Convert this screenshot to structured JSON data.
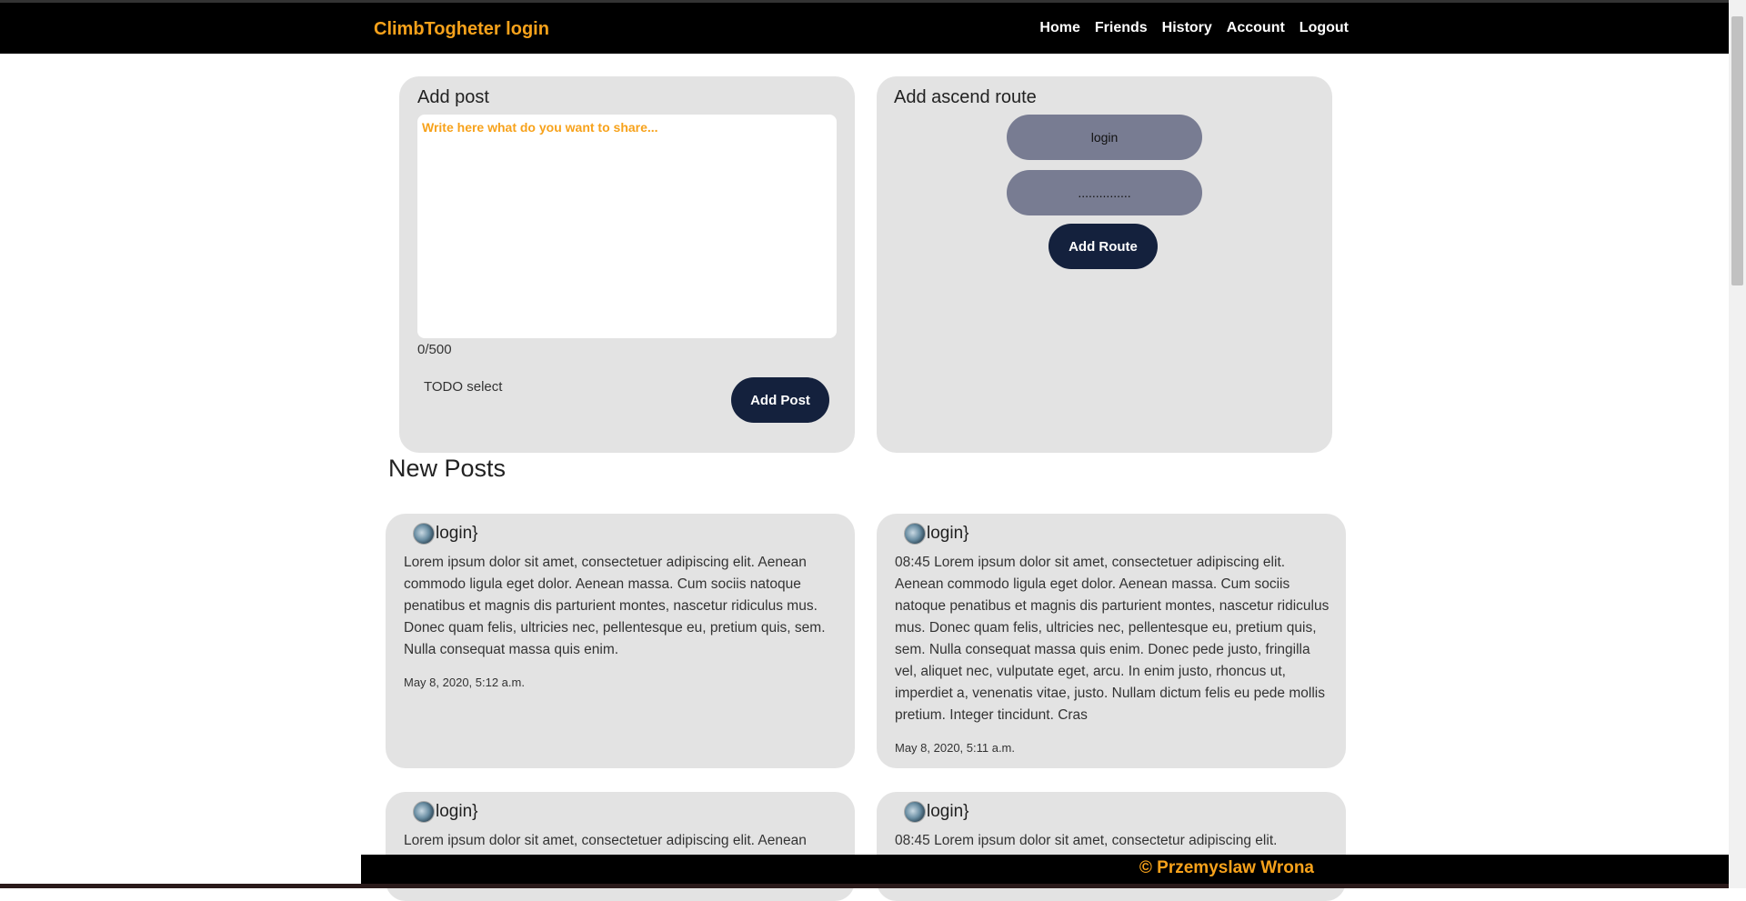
{
  "brand": "ClimbTogheter login",
  "nav": [
    "Home",
    "Friends",
    "History",
    "Account",
    "Logout"
  ],
  "add_post": {
    "title": "Add post",
    "placeholder": "Write here what do you want to share...",
    "char_count": "0/500",
    "todo_select": "TODO select",
    "submit_label": "Add Post"
  },
  "add_route": {
    "title": "Add ascend route",
    "login_placeholder": "login",
    "password_value": "...............",
    "submit_label": "Add Route"
  },
  "new_posts_title": "New Posts",
  "posts": [
    {
      "author": "login}",
      "body": "Lorem ipsum dolor sit amet, consectetuer adipiscing elit. Aenean commodo ligula eget dolor. Aenean massa. Cum sociis natoque penatibus et magnis dis parturient montes, nascetur ridiculus mus. Donec quam felis, ultricies nec, pellentesque eu, pretium quis, sem. Nulla consequat massa quis enim.",
      "date": "May 8, 2020, 5:12 a.m."
    },
    {
      "author": "login}",
      "body": "08:45 Lorem ipsum dolor sit amet, consectetuer adipiscing elit. Aenean commodo ligula eget dolor. Aenean massa. Cum sociis natoque penatibus et magnis dis parturient montes, nascetur ridiculus mus. Donec quam felis, ultricies nec, pellentesque eu, pretium quis, sem. Nulla consequat massa quis enim. Donec pede justo, fringilla vel, aliquet nec, vulputate eget, arcu. In enim justo, rhoncus ut, imperdiet a, venenatis vitae, justo. Nullam dictum felis eu pede mollis pretium. Integer tincidunt. Cras",
      "date": "May 8, 2020, 5:11 a.m."
    },
    {
      "author": "login}",
      "body": "Lorem ipsum dolor sit amet, consectetuer adipiscing elit. Aenean"
    },
    {
      "author": "login}",
      "body": "08:45 Lorem ipsum dolor sit amet, consectetur adipiscing elit."
    }
  ],
  "footer": "© Przemyslaw Wrona"
}
